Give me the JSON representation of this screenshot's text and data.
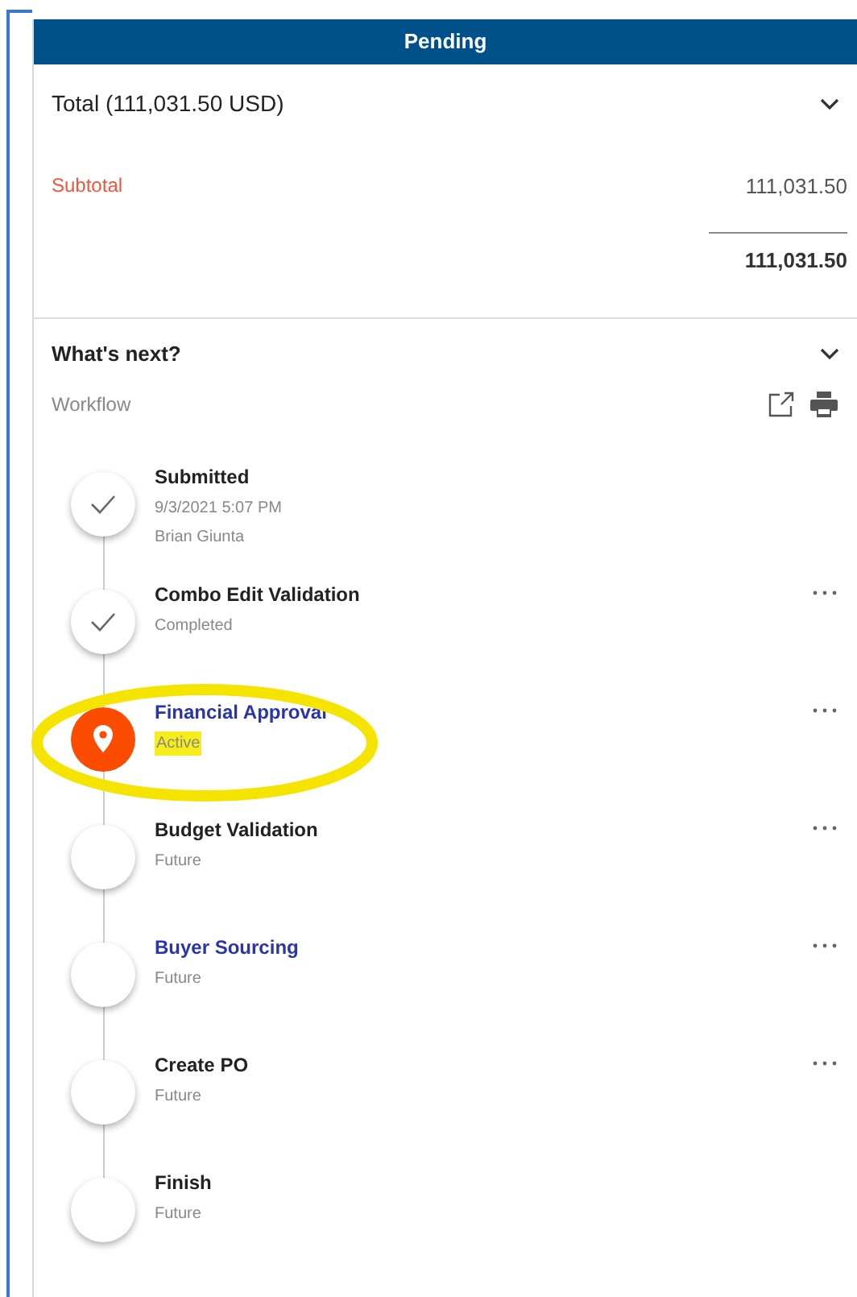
{
  "header": {
    "title": "Pending"
  },
  "total": {
    "title": "Total (111,031.50 USD)",
    "expanded": true,
    "subtotal_label": "Subtotal",
    "subtotal_value": "111,031.50",
    "sum": "111,031.50"
  },
  "whats_next": {
    "title": "What's next?",
    "expanded": true,
    "workflow_label": "Workflow"
  },
  "steps": [
    {
      "kind": "completed",
      "title": "Submitted",
      "link": false,
      "details": [
        "9/3/2021 5:07 PM",
        "Brian Giunta"
      ],
      "menu": false,
      "annotated": false
    },
    {
      "kind": "completed",
      "title": "Combo Edit Validation",
      "link": false,
      "details": [
        "Completed"
      ],
      "menu": true,
      "annotated": false
    },
    {
      "kind": "active",
      "title": "Financial Approval",
      "link": true,
      "details": [
        "Active"
      ],
      "menu": true,
      "annotated": true
    },
    {
      "kind": "future",
      "title": "Budget Validation",
      "link": false,
      "details": [
        "Future"
      ],
      "menu": true,
      "annotated": false
    },
    {
      "kind": "future",
      "title": "Buyer Sourcing",
      "link": true,
      "details": [
        "Future"
      ],
      "menu": true,
      "annotated": false
    },
    {
      "kind": "future",
      "title": "Create PO",
      "link": false,
      "details": [
        "Future"
      ],
      "menu": true,
      "annotated": false
    },
    {
      "kind": "future",
      "title": "Finish",
      "link": false,
      "details": [
        "Future"
      ],
      "menu": false,
      "annotated": false
    }
  ]
}
